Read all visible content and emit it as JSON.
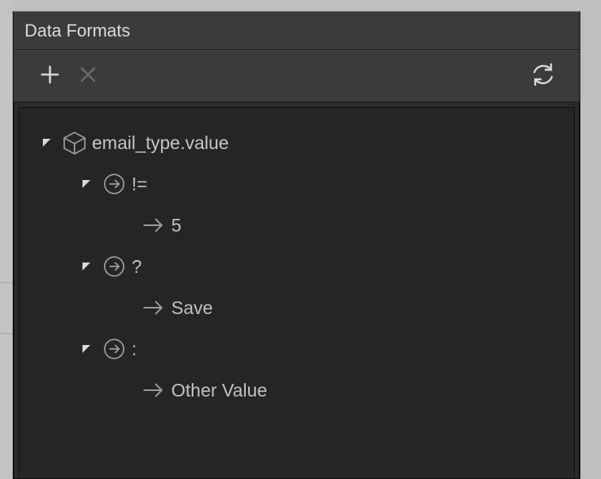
{
  "panel": {
    "title": "Data Formats"
  },
  "toolbar": {
    "add": "add",
    "delete": "delete",
    "refresh": "refresh"
  },
  "tree": {
    "root": {
      "label": "email_type.value"
    },
    "n1": {
      "label": "!="
    },
    "n1a": {
      "label": "5"
    },
    "n2": {
      "label": "?"
    },
    "n2a": {
      "label": "Save"
    },
    "n3": {
      "label": ":"
    },
    "n3a": {
      "label": "Other Value"
    }
  },
  "icons": {
    "cube": "cube-icon",
    "circleArrow": "arrow-circle-right-icon",
    "arrow": "arrow-right-icon",
    "expand": "expand-toggle-icon",
    "plus": "plus-icon",
    "close": "close-icon",
    "refresh": "refresh-icon"
  }
}
